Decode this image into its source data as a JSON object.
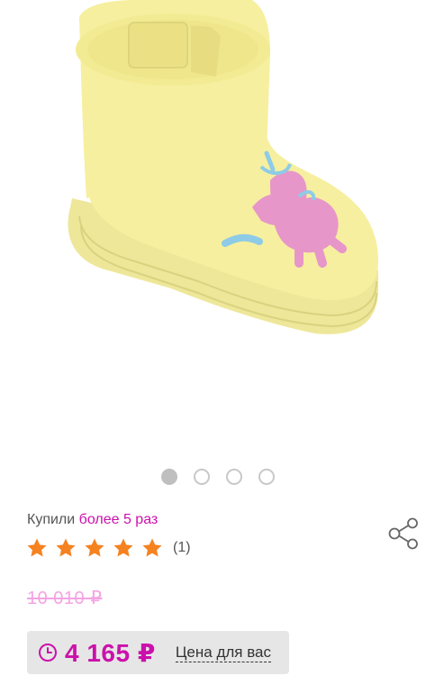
{
  "product": {
    "image_alt": "yellow rain boot with unicorn",
    "gallery_dots": 4,
    "active_dot": 0
  },
  "purchase_info": {
    "prefix": "Купили",
    "highlight": "более 5 раз"
  },
  "rating": {
    "stars": 5,
    "review_count": "(1)",
    "star_color": "#f58220"
  },
  "price": {
    "old": "10 010 ₽",
    "current": "4 165 ₽",
    "note": "Цена для вас",
    "accent_color": "#cb11ab"
  },
  "icons": {
    "share": "share-icon",
    "clock": "clock-icon",
    "star": "star-icon"
  }
}
